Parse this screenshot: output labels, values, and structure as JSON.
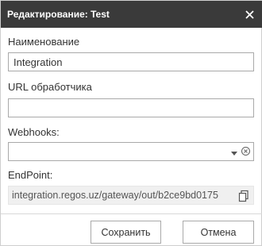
{
  "dialog": {
    "title": "Редактирование: Test",
    "close_icon": "close-icon"
  },
  "form": {
    "name_label": "Наименование",
    "name_value": "Integration",
    "url_label": "URL обработчика",
    "url_value": "",
    "webhooks_label": "Webhooks:",
    "webhooks_value": "",
    "endpoint_label": "EndPoint:",
    "endpoint_value": "integration.regos.uz/gateway/out/b2ce9bd0175"
  },
  "buttons": {
    "save_label": "Сохранить",
    "cancel_label": "Отмена"
  },
  "colors": {
    "titlebar": "#3a3a3a",
    "border": "#a9a9a9",
    "readonly_bg": "#f0f0f0"
  }
}
